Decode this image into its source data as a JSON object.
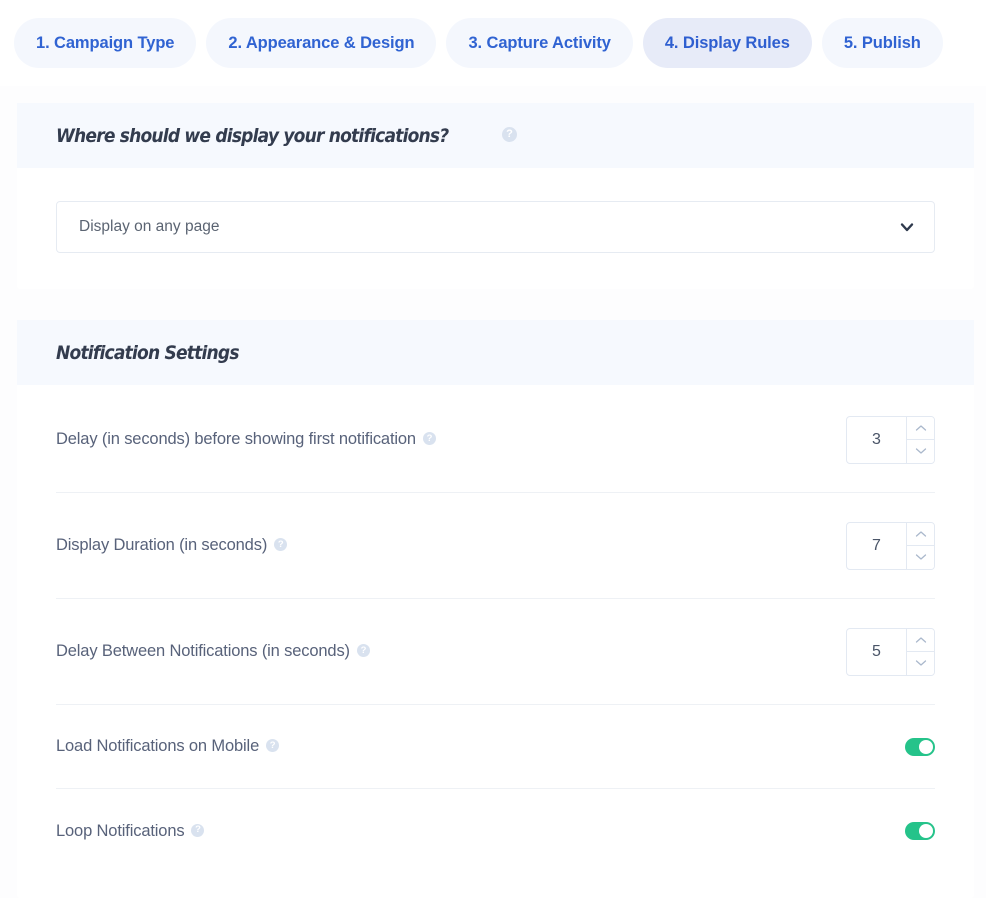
{
  "steps": {
    "tabs": [
      {
        "label": "1. Campaign Type",
        "active": false
      },
      {
        "label": "2. Appearance & Design",
        "active": false
      },
      {
        "label": "3. Capture Activity",
        "active": false
      },
      {
        "label": "4. Display Rules",
        "active": true
      },
      {
        "label": "5. Publish",
        "active": false
      }
    ]
  },
  "display_location": {
    "title": "Where should we display your notifications?",
    "help": "?",
    "select": {
      "value": "Display on any page",
      "chevron_icon": "chevron-down-icon"
    }
  },
  "notification_settings": {
    "title": "Notification Settings",
    "rows": [
      {
        "label": "Delay (in seconds) before showing first notification",
        "help": "?",
        "control": "spinner",
        "value": "3"
      },
      {
        "label": "Display Duration (in seconds)",
        "help": "?",
        "control": "spinner",
        "value": "7"
      },
      {
        "label": "Delay Between Notifications (in seconds)",
        "help": "?",
        "control": "spinner",
        "value": "5"
      },
      {
        "label": "Load Notifications on Mobile",
        "help": "?",
        "control": "toggle",
        "value": "on"
      },
      {
        "label": "Loop Notifications",
        "help": "?",
        "control": "toggle",
        "value": "on"
      }
    ]
  },
  "colors": {
    "tab_text": "#3063d2",
    "tab_bg": "#f4f7fd",
    "tab_active_bg": "#e7ebf8",
    "card_header_bg": "#f6f9fe",
    "heading": "#333c4e",
    "label": "#58627a",
    "toggle_on": "#25c38a",
    "help_icon": "#d9e2ef"
  }
}
